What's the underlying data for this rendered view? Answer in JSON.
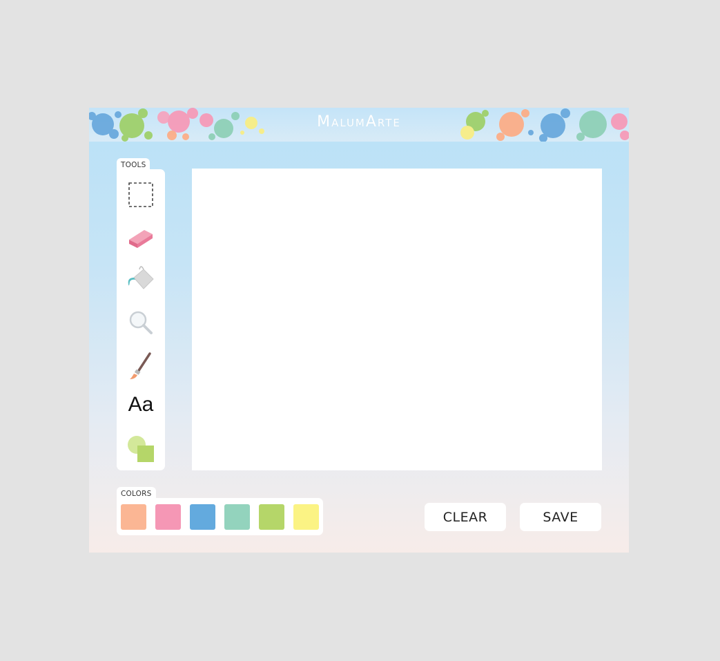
{
  "app": {
    "title": "MalumArte"
  },
  "tools": {
    "label": "TOOLS",
    "items": [
      {
        "name": "select",
        "icon": "dashed-select-icon"
      },
      {
        "name": "eraser",
        "icon": "eraser-icon"
      },
      {
        "name": "fill",
        "icon": "paint-bucket-icon"
      },
      {
        "name": "zoom",
        "icon": "magnifier-icon"
      },
      {
        "name": "brush",
        "icon": "paintbrush-icon"
      },
      {
        "name": "text",
        "icon": "text-icon",
        "text": "Aa"
      },
      {
        "name": "shapes",
        "icon": "shapes-icon"
      }
    ]
  },
  "colors": {
    "label": "COLORS",
    "swatches": [
      "#fbb694",
      "#f597b5",
      "#63aade",
      "#93d3bd",
      "#b5d669",
      "#fbf384"
    ]
  },
  "buttons": {
    "clear": "CLEAR",
    "save": "SAVE"
  }
}
